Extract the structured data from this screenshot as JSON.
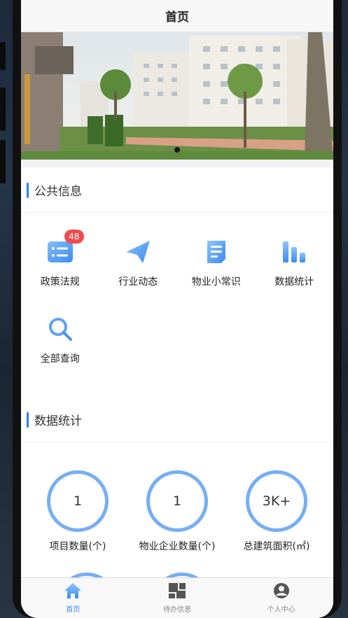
{
  "header": {
    "title": "首页"
  },
  "banner": {
    "alt": "residential-buildings-photo"
  },
  "public_info": {
    "title": "公共信息",
    "items": [
      {
        "label": "政策法规",
        "icon": "list-card-icon",
        "badge": "48"
      },
      {
        "label": "行业动态",
        "icon": "paper-plane-icon"
      },
      {
        "label": "物业小常识",
        "icon": "document-icon"
      },
      {
        "label": "数据统计",
        "icon": "bar-chart-icon"
      },
      {
        "label": "全部查询",
        "icon": "search-icon"
      }
    ]
  },
  "data_stats": {
    "title": "数据统计",
    "items": [
      {
        "value": "1",
        "label": "项目数量(个)"
      },
      {
        "value": "1",
        "label": "物业企业数量(个)"
      },
      {
        "value": "3K+",
        "label": "总建筑面积(㎡)"
      }
    ]
  },
  "tabbar": {
    "items": [
      {
        "label": "首页",
        "icon": "home-icon",
        "active": true
      },
      {
        "label": "待办信息",
        "icon": "grid-icon"
      },
      {
        "label": "个人中心",
        "icon": "user-icon"
      }
    ]
  },
  "colors": {
    "accent": "#2f7ef7",
    "icon_blue": "#5fa3f5",
    "badge": "#f24b4b",
    "ring": "#75aef5"
  }
}
